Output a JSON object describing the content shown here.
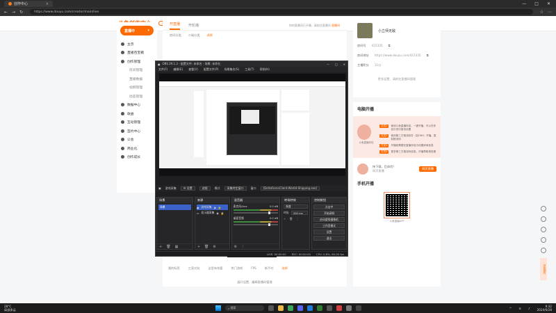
{
  "browser": {
    "tab_title": "创作中心",
    "url": "https://www.douyu.com/creator/main/live",
    "window_controls": [
      "—",
      "□",
      "✕"
    ]
  },
  "site": {
    "logo": "斗鱼创作中心",
    "home_label": "返回首页",
    "header_right": [
      "下载APP",
      "消息"
    ],
    "sidebar": {
      "live_button": "直播中",
      "items": [
        "主页",
        "直播百宝箱",
        "创作管理",
        "房间管理",
        "直播数据",
        "视频管理",
        "数据中心",
        "收益",
        "互动管理",
        "签约中心",
        "公会",
        "商业化",
        "创作成长"
      ],
      "sub_items": [
        "房间管理",
        "直播数据",
        "视频管理",
        "动态管理"
      ]
    },
    "main": {
      "tabs": [
        "开直播",
        "开轮播"
      ],
      "notice": "你的直播间已开播，请前往直播间 ",
      "notice_link": "直播间",
      "filters": [
        "房间分类",
        "二级分类",
        "选择"
      ],
      "bottom_tags": [
        "我的标签",
        "三家对抗",
        "这里有惊喜",
        "热门游戏",
        "FPS",
        "新手村",
        "选择"
      ],
      "bottom_more": "展开设置、编辑直播间管理"
    },
    "profile": {
      "name": "小立师无敌",
      "room_label": "房间号",
      "room_value": "415335",
      "addr_label": "房间地址",
      "addr_value": "https://www.douyu.com/415335",
      "level_label": "主播积分",
      "level_value": "11分",
      "more": "更多设置、请前往直播间管理"
    },
    "start": {
      "title": "电脑开播",
      "mascot_label": "斗鱼直播伴侣",
      "options": [
        {
          "tag": "方式1",
          "text": "使用斗鱼直播伴侣，一键开播，可以在伴侣中进行推流设置"
        },
        {
          "tag": "方式2",
          "text": "使用第三方推流软件（如OBS）开播，复制推流码"
        },
        {
          "tag": "方式3",
          "text": "开播前需要在直播伴侣中设置房间信息"
        },
        {
          "tag": "方式4",
          "text": "更多第三方推流码信息，开播帮助请查看"
        }
      ],
      "web_text": "快下载，后体验！",
      "web_sub": "网页直播",
      "web_button": "网页直播",
      "qr_title": "手机开播",
      "qr_caption": "斗鱼直播APP"
    },
    "float_tag": "领取福利"
  },
  "obs": {
    "title": "OBS 29.1.3 - 配置文件: 未命名 - 场景: 未命名",
    "menu": [
      "文件(F)",
      "编辑(E)",
      "查看(V)",
      "配置文件(P)",
      "场景集合(S)",
      "工具(T)",
      "帮助(H)"
    ],
    "toolbar": {
      "source": "游戏采集",
      "props": "设置",
      "filters": "滤镜",
      "mode_label": "模式",
      "mode_value": "采集特定窗口",
      "window_label": "窗口",
      "window_value": "[DeltaForceClient-Win64-Shipping.exe]"
    },
    "docks": {
      "scenes": {
        "title": "场景",
        "items": [
          "场景"
        ]
      },
      "sources": {
        "title": "来源",
        "items": [
          "游戏采集",
          "显示器采集"
        ]
      },
      "mixer": {
        "title": "混音器",
        "channels": [
          {
            "name": "麦克风/Aux",
            "db": "0.0 dB"
          },
          {
            "name": "桌面音频",
            "db": "0.0 dB"
          }
        ]
      },
      "transitions": {
        "title": "转场特效",
        "type": "渐变",
        "duration_label": "时长",
        "duration": "300 ms"
      },
      "controls": {
        "title": "控制按钮",
        "buttons": [
          "点击中",
          "开始录制",
          "启动虚拟摄像机",
          "工作室模式",
          "设置",
          "退出"
        ]
      }
    },
    "status": {
      "live": "LIVE: 00:00:00",
      "rec": "REC: 00:00:00",
      "cpu": "CPU: 0.8%, 60.00 fps"
    }
  },
  "taskbar": {
    "weather_temp": "28°C",
    "weather_text": "局部多云",
    "search": "搜索",
    "time": "9:32",
    "date": "2024/6/28"
  }
}
